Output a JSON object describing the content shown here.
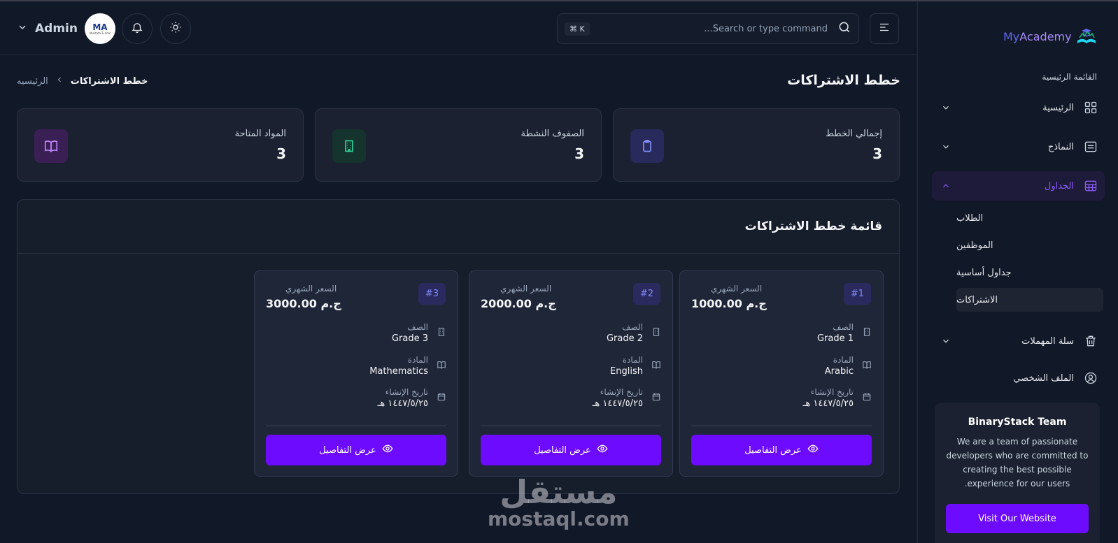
{
  "header": {
    "admin_name": "Admin",
    "avatar_text": "MA",
    "avatar_subtext": "Mustafa & Amr",
    "search_placeholder": "Search or type command...",
    "search_shortcut": "⌘ K"
  },
  "page": {
    "title": "خطط الاشتراكات",
    "breadcrumb_current": "خطط الاشتراكات",
    "breadcrumb_home": "الرئيسيه"
  },
  "stats": [
    {
      "label": "إجمالي الخطط",
      "value": "3",
      "icon": "clipboard-icon",
      "color": "#818cf8",
      "bg": "#272a5a"
    },
    {
      "label": "الصفوف النشطة",
      "value": "3",
      "icon": "building-icon",
      "color": "#34d399",
      "bg": "#14342d"
    },
    {
      "label": "المواد المتاحة",
      "value": "3",
      "icon": "book-icon",
      "color": "#c084fc",
      "bg": "#3a1f55"
    }
  ],
  "plans_panel": {
    "title": "قائمة خطط الاشتراكات",
    "price_label": "السعر الشهري",
    "grade_label": "الصف",
    "subject_label": "المادة",
    "date_label": "تاريخ الإنشاء",
    "button_label": "عرض التفاصيل",
    "plans": [
      {
        "badge": "#1",
        "price": "1000.00 ج.م",
        "grade": "Grade 1",
        "subject": "Arabic",
        "date": "١٤٤٧/٥/٢٥ هـ"
      },
      {
        "badge": "#2",
        "price": "2000.00 ج.م",
        "grade": "Grade 2",
        "subject": "English",
        "date": "١٤٤٧/٥/٢٥ هـ"
      },
      {
        "badge": "#3",
        "price": "3000.00 ج.م",
        "grade": "Grade 3",
        "subject": "Mathematics",
        "date": "١٤٤٧/٥/٢٥ هـ"
      }
    ]
  },
  "sidebar": {
    "logo_prefix": "My",
    "logo_suffix": "Academy",
    "section_title": "القائمة الرئيسية",
    "items": [
      {
        "label": "الرئيسية",
        "icon": "grid-icon"
      },
      {
        "label": "النماذج",
        "icon": "form-icon"
      },
      {
        "label": "الجداول",
        "icon": "table-icon"
      },
      {
        "label": "سلة المهملات",
        "icon": "trash-icon"
      },
      {
        "label": "الملف الشخصي",
        "icon": "user-circle-icon"
      }
    ],
    "subitems": [
      "الطلاب",
      "الموظفين",
      "جداول أساسية",
      "الاشتراكات"
    ],
    "team": {
      "title": "BinaryStack Team",
      "description": "We are a team of passionate developers who are committed to creating the best possible experience for our users.",
      "button": "Visit Our Website"
    }
  },
  "watermark": {
    "arabic": "مستقل",
    "latin": "mostaql.com"
  },
  "colors": {
    "accent": "#6d0bff",
    "background": "#111827",
    "card": "#1b2130"
  }
}
